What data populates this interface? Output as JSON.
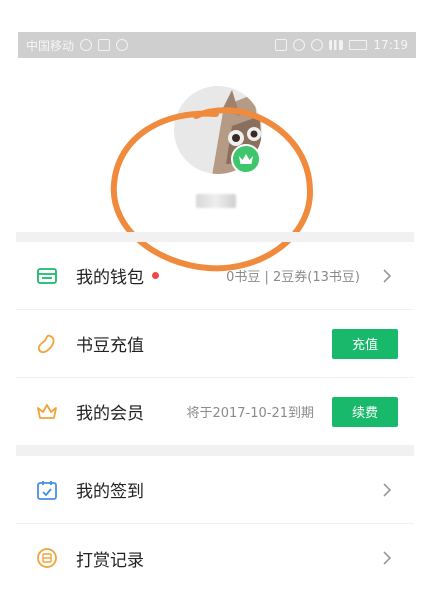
{
  "status_bar": {
    "carrier": "中国移动",
    "time": "17:19"
  },
  "menu": {
    "wallet": {
      "label": "我的钱包",
      "info": "0书豆 | 2豆券(13书豆)"
    },
    "recharge": {
      "label": "书豆充值",
      "button": "充值"
    },
    "membership": {
      "label": "我的会员",
      "info": "将于2017-10-21到期",
      "button": "续费"
    },
    "checkin": {
      "label": "我的签到"
    },
    "rewards": {
      "label": "打赏记录"
    }
  },
  "colors": {
    "accent_green": "#19b96b",
    "notification_dot": "#f04848",
    "scribble_orange": "#f08a3c",
    "crown_icon": "#f1a33a"
  }
}
